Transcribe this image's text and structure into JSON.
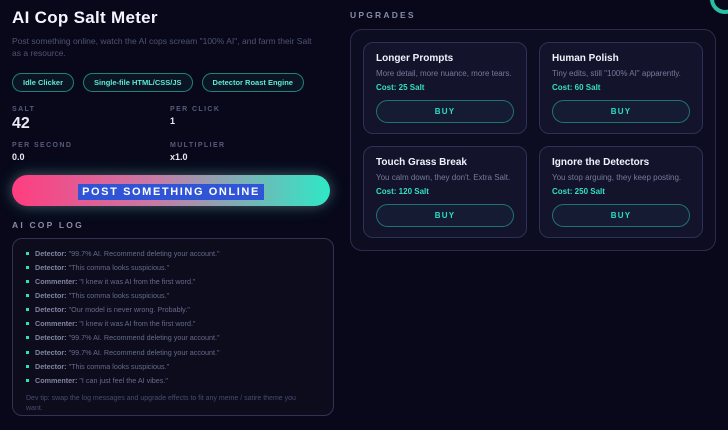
{
  "colors": {
    "background": "#08081a",
    "accent_teal": "#2de0c0",
    "accent_pink": "#ff3d7f",
    "selection_blue": "#3054d6"
  },
  "header": {
    "title": "AI Cop Salt Meter",
    "subtitle": "Post something online, watch the AI cops scream \"100% AI\", and farm their Salt as a resource."
  },
  "badges": [
    {
      "label": "Idle Clicker"
    },
    {
      "label": "Single-file HTML/CSS/JS"
    },
    {
      "label": "Detector Roast Engine"
    }
  ],
  "stats": [
    {
      "label": "SALT",
      "value": "42"
    },
    {
      "label": "PER CLICK",
      "value": "1"
    },
    {
      "label": "PER SECOND",
      "value": "0.0"
    },
    {
      "label": "MULTIPLIER",
      "value": "x1.0"
    }
  ],
  "post_button": {
    "label": "POST SOMETHING ONLINE"
  },
  "log": {
    "title": "AI COP LOG",
    "entries": [
      {
        "source": "Detector:",
        "message": "\"99.7% AI. Recommend deleting your account.\""
      },
      {
        "source": "Detector:",
        "message": "\"This comma looks suspicious.\""
      },
      {
        "source": "Commenter:",
        "message": "\"I knew it was AI from the first word.\""
      },
      {
        "source": "Detector:",
        "message": "\"This comma looks suspicious.\""
      },
      {
        "source": "Detector:",
        "message": "\"Our model is never wrong. Probably.\""
      },
      {
        "source": "Commenter:",
        "message": "\"I knew it was AI from the first word.\""
      },
      {
        "source": "Detector:",
        "message": "\"99.7% AI. Recommend deleting your account.\""
      },
      {
        "source": "Detector:",
        "message": "\"99.7% AI. Recommend deleting your account.\""
      },
      {
        "source": "Detector:",
        "message": "\"This comma looks suspicious.\""
      },
      {
        "source": "Commenter:",
        "message": "\"I can just feel the AI vibes.\""
      }
    ],
    "dev_tip": "Dev tip: swap the log messages and upgrade effects to fit any meme / satire theme you want."
  },
  "upgrades": {
    "title": "UPGRADES",
    "buy_label": "BUY",
    "cards": [
      {
        "name": "Longer Prompts",
        "description": "More detail, more nuance, more tears.",
        "cost": "Cost: 25 Salt"
      },
      {
        "name": "Human Polish",
        "description": "Tiny edits, still \"100% AI\" apparently.",
        "cost": "Cost: 60 Salt"
      },
      {
        "name": "Touch Grass Break",
        "description": "You calm down, they don't. Extra Salt.",
        "cost": "Cost: 120 Salt"
      },
      {
        "name": "Ignore the Detectors",
        "description": "You stop arguing, they keep posting.",
        "cost": "Cost: 250 Salt"
      }
    ]
  }
}
